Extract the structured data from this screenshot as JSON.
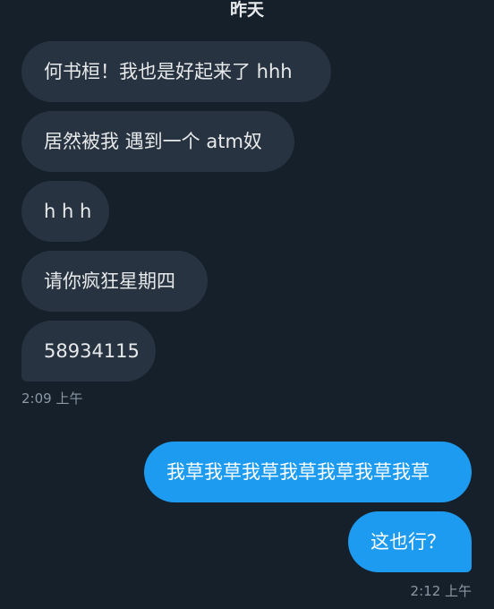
{
  "conversation": {
    "date_header": "昨天",
    "incoming_messages": [
      {
        "text": "何书桓！我也是好起来了 hhh"
      },
      {
        "text": "居然被我 遇到一个 atm奴"
      },
      {
        "text": "h h h"
      },
      {
        "text": "请你疯狂星期四"
      },
      {
        "text": "58934115"
      }
    ],
    "incoming_timestamp": "2:09 上午",
    "outgoing_messages": [
      {
        "text": "我草我草我草我草我草我草我草"
      },
      {
        "text": "这也行？"
      }
    ],
    "outgoing_timestamp": "2:12 上午"
  },
  "colors": {
    "background": "#15202b",
    "incoming_bubble": "#273340",
    "outgoing_bubble": "#1d9bf0",
    "timestamp_text": "#8b98a5"
  }
}
